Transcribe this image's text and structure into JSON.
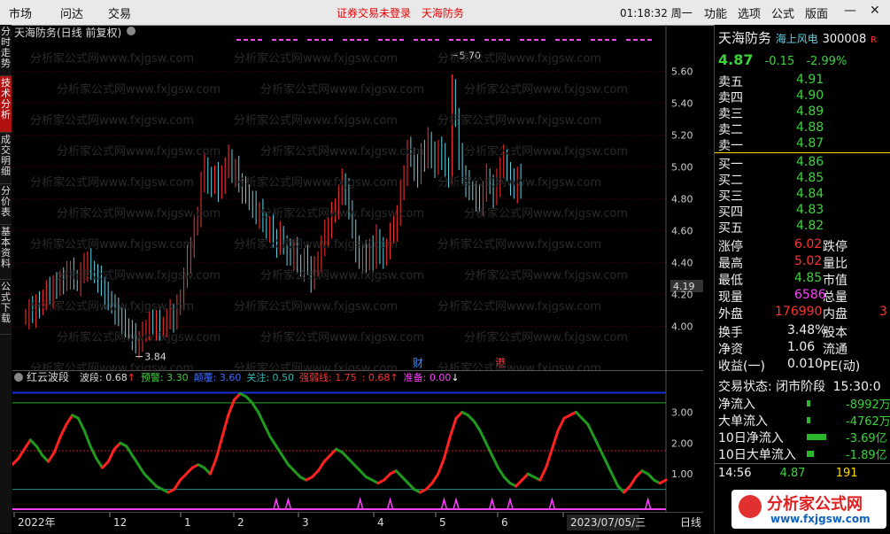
{
  "topbar": {
    "menus": [
      "市场",
      "问达",
      "交易"
    ],
    "alert_1": "证券交易未登录",
    "alert_2": "天海防务",
    "time": "01:18:32 周一",
    "right_menus": [
      "功能",
      "选项",
      "公式",
      "版面"
    ]
  },
  "left_tabs": [
    "分时走势",
    "技术分析",
    "成交明细",
    "分价表",
    "基本资料",
    "公式下载"
  ],
  "chart": {
    "title": "天海防务(日线 前复权)",
    "watermark": "分析家公式网www.fxjgsw.com",
    "high_label": "5.70",
    "low_label": "3.84",
    "current_price_tag": "4.19",
    "event_markers": [
      "财",
      "港"
    ],
    "price_axis": [
      "5.60",
      "5.40",
      "5.20",
      "5.00",
      "4.80",
      "4.60",
      "4.40",
      "4.20",
      "4.00"
    ],
    "ylim": [
      3.78,
      5.78
    ]
  },
  "indicator": {
    "name": "红云波段",
    "params": [
      {
        "label": "波段: 0.68",
        "arrow": "↑",
        "color": "#dddddd",
        "arrow_color": "#ff3232"
      },
      {
        "label": "预警: 3.30",
        "arrow": "",
        "color": "#3cd23c"
      },
      {
        "label": "颠覆: 3.60",
        "arrow": "",
        "color": "#3a6cff"
      },
      {
        "label": "关注: 0.50",
        "arrow": "",
        "color": "#33b3b3"
      },
      {
        "label": "强弱线: 1.75",
        "arrow": "",
        "color": "#ff3232"
      },
      {
        "label": ": 0.68",
        "arrow": "↑",
        "color": "#ff3232",
        "arrow_color": "#ff3232"
      },
      {
        "label": "准备: 0.00",
        "arrow": "↓",
        "color": "#ff40ff",
        "arrow_color": "#ffffff"
      }
    ],
    "axis": [
      "3.00",
      "2.00",
      "1.00"
    ],
    "ylim": [
      0,
      3.9
    ]
  },
  "xaxis": {
    "labels": [
      "2022年",
      "12",
      "1",
      "2",
      "3",
      "4",
      "5",
      "6",
      "7"
    ],
    "cursor_date": "2023/07/05/三",
    "period": "日线"
  },
  "quote": {
    "name": "天海防务",
    "sector": "海上风电",
    "code": "300008",
    "flag": "R",
    "price": "4.87",
    "change": "-0.15",
    "change_pct": "-2.99%",
    "asks": [
      {
        "label": "卖五",
        "price": "4.91"
      },
      {
        "label": "卖四",
        "price": "4.90"
      },
      {
        "label": "卖三",
        "price": "4.89"
      },
      {
        "label": "卖二",
        "price": "4.88"
      },
      {
        "label": "卖一",
        "price": "4.87"
      }
    ],
    "bids": [
      {
        "label": "买一",
        "price": "4.86"
      },
      {
        "label": "买二",
        "price": "4.85"
      },
      {
        "label": "买三",
        "price": "4.84"
      },
      {
        "label": "买四",
        "price": "4.83"
      },
      {
        "label": "买五",
        "price": "4.82"
      }
    ],
    "stats": [
      {
        "label": "涨停",
        "value": "6.02",
        "color": "#ff3232",
        "label2": "跌停"
      },
      {
        "label": "最高",
        "value": "5.02",
        "color": "#ff3232",
        "label2": "量比"
      },
      {
        "label": "最低",
        "value": "4.85",
        "color": "#3cd23c",
        "label2": "市值"
      },
      {
        "label": "现量",
        "value": "6586",
        "color": "#ff40ff",
        "label2": "总量"
      },
      {
        "label": "外盘",
        "value": "176990",
        "color": "#ff3232",
        "label2": "内盘",
        "extra": "3"
      }
    ],
    "stats2": [
      {
        "label": "换手",
        "value": "3.48%",
        "label2": "股本"
      },
      {
        "label": "净资",
        "value": "1.06",
        "label2": "流通"
      },
      {
        "label": "收益(一)",
        "value": "0.010",
        "label2": "PE(动)"
      }
    ],
    "trade_state": "交易状态: 闭市阶段",
    "trade_time": "15:30:0",
    "flows": [
      {
        "label": "净流入",
        "value": "-8992万"
      },
      {
        "label": "大单流入",
        "value": "-4762万"
      },
      {
        "label": "10日净流入",
        "value": "-3.69亿"
      },
      {
        "label": "10日大单流入",
        "value": "-1.89亿"
      }
    ],
    "last_trade": {
      "time": "14:56",
      "price": "4.87",
      "vol": "191"
    }
  },
  "logo": {
    "title": "分析家公式网",
    "url": "www.fxjgsw.com"
  },
  "chart_data": {
    "type": "candlestick",
    "title": "天海防务(日线 前复权)",
    "close": [
      4.06,
      4.1,
      4.08,
      4.14,
      4.12,
      4.18,
      4.22,
      4.2,
      4.26,
      4.24,
      4.3,
      4.28,
      4.32,
      4.35,
      4.3,
      4.27,
      4.33,
      4.37,
      4.41,
      4.36,
      4.32,
      4.29,
      4.25,
      4.2,
      4.17,
      4.13,
      4.09,
      4.06,
      4.04,
      4.0,
      3.97,
      3.93,
      3.89,
      3.91,
      3.95,
      3.99,
      4.02,
      4.0,
      4.04,
      3.98,
      4.01,
      4.04,
      4.08,
      4.05,
      4.12,
      4.18,
      4.3,
      4.42,
      4.5,
      4.62,
      4.7,
      4.9,
      5.0,
      4.92,
      4.88,
      4.96,
      4.86,
      4.92,
      5.0,
      5.06,
      4.95,
      4.98,
      4.9,
      4.86,
      4.84,
      4.78,
      4.76,
      4.7,
      4.72,
      4.66,
      4.6,
      4.62,
      4.55,
      4.52,
      4.58,
      4.5,
      4.46,
      4.44,
      4.48,
      4.4,
      4.36,
      4.42,
      4.38,
      4.3,
      4.36,
      4.42,
      4.5,
      4.58,
      4.62,
      4.7,
      4.75,
      4.82,
      4.9,
      4.85,
      4.74,
      4.6,
      4.48,
      4.42,
      4.46,
      4.4,
      4.5,
      4.42,
      4.55,
      4.48,
      4.43,
      4.5,
      4.58,
      4.62,
      4.7,
      4.84,
      4.96,
      5.1,
      5.06,
      5.0,
      4.94,
      5.1,
      5.05,
      5.16,
      5.08,
      5.0,
      5.12,
      5.06,
      5.0,
      4.96,
      5.5,
      5.3,
      5.06,
      4.95,
      4.9,
      4.86,
      4.84,
      4.8,
      4.78,
      4.85,
      4.94,
      4.88,
      4.82,
      4.9,
      5.0,
      5.06,
      4.96,
      4.9,
      4.86,
      4.94,
      4.87
    ]
  },
  "indicator_data": {
    "values": [
      1.3,
      1.5,
      1.8,
      2.1,
      1.9,
      1.6,
      1.4,
      1.7,
      2.2,
      2.6,
      2.9,
      2.8,
      2.4,
      1.9,
      1.5,
      1.2,
      1.4,
      1.8,
      2.0,
      1.9,
      1.6,
      1.3,
      1.0,
      0.8,
      0.6,
      0.5,
      0.4,
      0.5,
      0.8,
      1.0,
      1.2,
      1.3,
      1.2,
      1.0,
      1.5,
      2.2,
      2.9,
      3.4,
      3.6,
      3.5,
      3.3,
      3.0,
      2.6,
      2.2,
      1.9,
      1.6,
      1.3,
      1.1,
      0.9,
      0.8,
      0.9,
      1.1,
      1.4,
      1.6,
      1.8,
      1.7,
      1.5,
      1.3,
      1.1,
      0.9,
      0.8,
      0.7,
      0.8,
      1.0,
      1.1,
      0.9,
      0.7,
      0.5,
      0.4,
      0.5,
      0.7,
      1.0,
      1.5,
      2.2,
      2.8,
      3.0,
      2.9,
      2.7,
      2.4,
      2.0,
      1.6,
      1.2,
      0.9,
      0.7,
      0.6,
      0.8,
      1.0,
      0.9,
      0.8,
      1.2,
      1.8,
      2.4,
      2.8,
      2.9,
      3.0,
      2.8,
      2.6,
      2.2,
      1.8,
      1.4,
      1.0,
      0.6,
      0.4,
      0.6,
      0.9,
      1.1,
      1.0,
      0.8,
      0.7,
      0.8
    ],
    "warn": 3.3,
    "top": 3.6,
    "focus": 0.5,
    "strength": 1.75,
    "ready_markers": [
      44,
      46,
      58,
      63,
      72,
      74,
      80,
      83,
      90,
      106
    ]
  }
}
